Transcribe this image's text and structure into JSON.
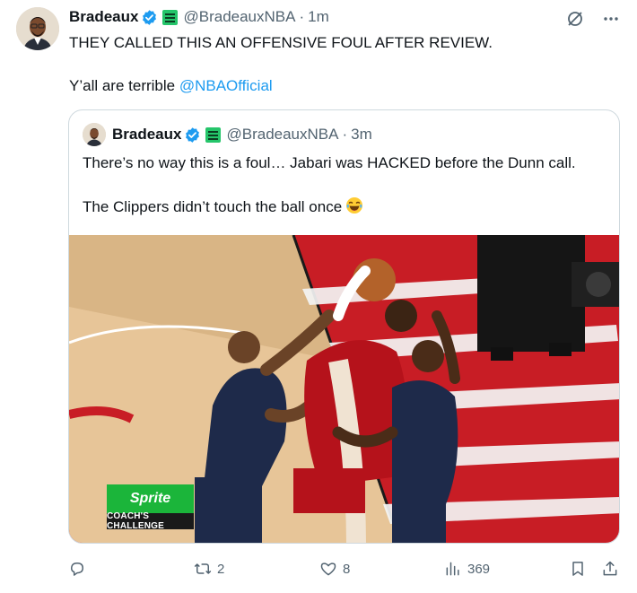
{
  "tweet": {
    "author_name": "Bradeaux",
    "author_handle": "@BradeauxNBA",
    "separator": "·",
    "time": "1m",
    "line1": "THEY CALLED THIS AN OFFENSIVE FOUL AFTER REVIEW.",
    "line2_prefix": "Y’all are terrible ",
    "line2_mention": "@NBAOfficial"
  },
  "quoted": {
    "author_name": "Bradeaux",
    "author_handle": "@BradeauxNBA",
    "separator": "·",
    "time": "3m",
    "line1": "There’s no way this is a foul… Jabari was HACKED before the Dunn call.",
    "line2": "The Clippers didn’t touch the ball once",
    "emoji": "face-with-tears-of-joy",
    "media": {
      "sprite_label": "Sprite",
      "challenge_label": "COACH'S CHALLENGE"
    }
  },
  "actions": {
    "reply_count": "",
    "repost_count": "2",
    "like_count": "8",
    "views_count": "369"
  },
  "colors": {
    "text": "#0f1419",
    "secondary": "#536471",
    "link": "#1d9bf0",
    "border": "#cfd9de",
    "verified": "#1d9bf0",
    "sprite_green": "#1bb53a"
  },
  "icons": [
    "verified-badge-icon",
    "affiliate-badge-icon",
    "grok-icon",
    "more-icon",
    "reply-icon",
    "repost-icon",
    "like-icon",
    "views-icon",
    "bookmark-icon",
    "share-icon"
  ]
}
